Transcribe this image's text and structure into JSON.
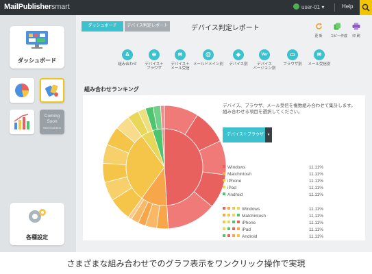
{
  "header": {
    "brand_main": "MailPublisher",
    "brand_sub": "smart",
    "user": "user-01",
    "help": "Help"
  },
  "sidebar": {
    "dashboard_label": "ダッシュボード",
    "coming_soon_line1": "Coming",
    "coming_soon_line2": "Soon",
    "coming_soon_line3": "Next Evolution",
    "settings_label": "各種設定"
  },
  "breadcrumb": [
    "ダッシュボード",
    "デバイス判定レポート"
  ],
  "page_title": "デバイス判定レポート",
  "toolbar": [
    {
      "label": "更 新",
      "icon": "refresh-icon",
      "color": "#f0a020"
    },
    {
      "label": "コピー作成",
      "icon": "copy-icon",
      "color": "#49b749"
    },
    {
      "label": "印 刷",
      "icon": "print-icon",
      "color": "#8a56c2"
    }
  ],
  "filters": [
    {
      "label1": "組み合わせ",
      "label2": "",
      "glyph": "&"
    },
    {
      "label1": "デバイス＋",
      "label2": "ブラウザ",
      "glyph": "⊕"
    },
    {
      "label1": "デバイス＋",
      "label2": "メール受信",
      "glyph": "✉"
    },
    {
      "label1": "メールドメイン別",
      "label2": "",
      "glyph": "@"
    },
    {
      "label1": "デバイス別",
      "label2": "",
      "glyph": "◈"
    },
    {
      "label1": "デバイス",
      "label2": "バージョン別",
      "glyph": "Ver"
    },
    {
      "label1": "ブラウザ別",
      "label2": "",
      "glyph": "▭"
    },
    {
      "label1": "メール受信別",
      "label2": "",
      "glyph": "✉"
    }
  ],
  "section_title": "組み合わせランキング",
  "panel": {
    "description_line1": "デバイス、ブラウザ、メール受信を複数組み合わせて集計します。",
    "description_line2": "組み合わせる項目を選択してください。",
    "dropdown_value": "デバイス＋ブラウザ",
    "dropdown_arrow": "▾"
  },
  "legend_colors": [
    "#e8615f",
    "#f7a64a",
    "#f5c54a",
    "#e9d75a",
    "#4fc46e"
  ],
  "legend_group1": [
    {
      "name": "Windows",
      "pct": "11.11%"
    },
    {
      "name": "Matchintosh",
      "pct": "11.11%"
    },
    {
      "name": "iPhone",
      "pct": "11.11%"
    },
    {
      "name": "iPad",
      "pct": "11.11%"
    },
    {
      "name": "Android",
      "pct": "11.11%"
    }
  ],
  "legend_group2": [
    {
      "name": "Windows",
      "pct": "11.11%"
    },
    {
      "name": "Matchintosh",
      "pct": "11.11%"
    },
    {
      "name": "iPhone",
      "pct": "11.11%"
    },
    {
      "name": "iPad",
      "pct": "11.11%"
    },
    {
      "name": "Android",
      "pct": "11.11%"
    }
  ],
  "chart_data": {
    "type": "pie",
    "description": "sunburst",
    "inner_ring": [
      {
        "color": "#e8615f",
        "value": 49
      },
      {
        "color": "#f7a64a",
        "value": 11
      },
      {
        "color": "#f5c54a",
        "value": 30
      },
      {
        "color": "#e9d75a",
        "value": 5
      },
      {
        "color": "#4fc46e",
        "value": 4
      },
      {
        "color": "#ef8d8c",
        "value": 1
      }
    ],
    "outer_ring": [
      {
        "color": "#ef7a78",
        "value": 9
      },
      {
        "color": "#e8615f",
        "value": 9
      },
      {
        "color": "#ef7a78",
        "value": 9
      },
      {
        "color": "#e8615f",
        "value": 9
      },
      {
        "color": "#ef7a78",
        "value": 13
      },
      {
        "color": "#f7a64a",
        "value": 3
      },
      {
        "color": "#f9b866",
        "value": 3
      },
      {
        "color": "#f7a64a",
        "value": 2
      },
      {
        "color": "#f9b866",
        "value": 2
      },
      {
        "color": "#fbc989",
        "value": 1
      },
      {
        "color": "#f5c54a",
        "value": 6
      },
      {
        "color": "#f7d06b",
        "value": 5
      },
      {
        "color": "#f5c54a",
        "value": 5
      },
      {
        "color": "#f7d06b",
        "value": 5
      },
      {
        "color": "#f5c54a",
        "value": 5
      },
      {
        "color": "#f9db8c",
        "value": 4
      },
      {
        "color": "#e9d75a",
        "value": 3
      },
      {
        "color": "#eddf7c",
        "value": 2
      },
      {
        "color": "#4fc46e",
        "value": 2
      },
      {
        "color": "#72d08b",
        "value": 2
      },
      {
        "color": "#ef8d8c",
        "value": 1
      }
    ]
  }
}
